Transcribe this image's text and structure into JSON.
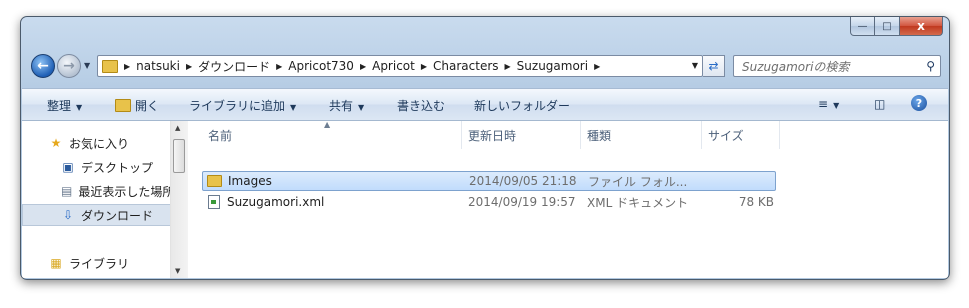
{
  "window": {
    "caption": {
      "min": "—",
      "max": "□",
      "close": "x"
    }
  },
  "nav": {
    "back_icon": "back-arrow-icon",
    "forward_icon": "forward-arrow-icon",
    "breadcrumb": [
      "natsuki",
      "ダウンロード",
      "Apricot730",
      "Apricot",
      "Characters",
      "Suzugamori"
    ],
    "search_placeholder": "Suzugamoriの検索"
  },
  "toolbar": {
    "organize": "整理",
    "open": "開く",
    "add_to_library": "ライブラリに追加",
    "share": "共有",
    "burn": "書き込む",
    "new_folder": "新しいフォルダー"
  },
  "sidebar": {
    "items": [
      {
        "label": "お気に入り",
        "icon": "star-icon"
      },
      {
        "label": "デスクトップ",
        "icon": "desktop-icon"
      },
      {
        "label": "最近表示した場所",
        "icon": "recent-places-icon"
      },
      {
        "label": "ダウンロード",
        "icon": "downloads-icon",
        "selected": true
      },
      {
        "label": "ライブラリ",
        "icon": "library-icon"
      }
    ]
  },
  "columns": {
    "name": "名前",
    "date": "更新日時",
    "type": "種類",
    "size": "サイズ"
  },
  "files": [
    {
      "name": "Images",
      "date": "2014/09/05 21:18",
      "type": "ファイル フォル...",
      "size": "",
      "icon": "folder-icon",
      "selected": true
    },
    {
      "name": "Suzugamori.xml",
      "date": "2014/09/19 19:57",
      "type": "XML ドキュメント",
      "size": "78 KB",
      "icon": "xml-file-icon"
    }
  ],
  "colors": {
    "selection": "#c1dcfc",
    "accent": "#1f5fb5",
    "close": "#c0391f"
  }
}
